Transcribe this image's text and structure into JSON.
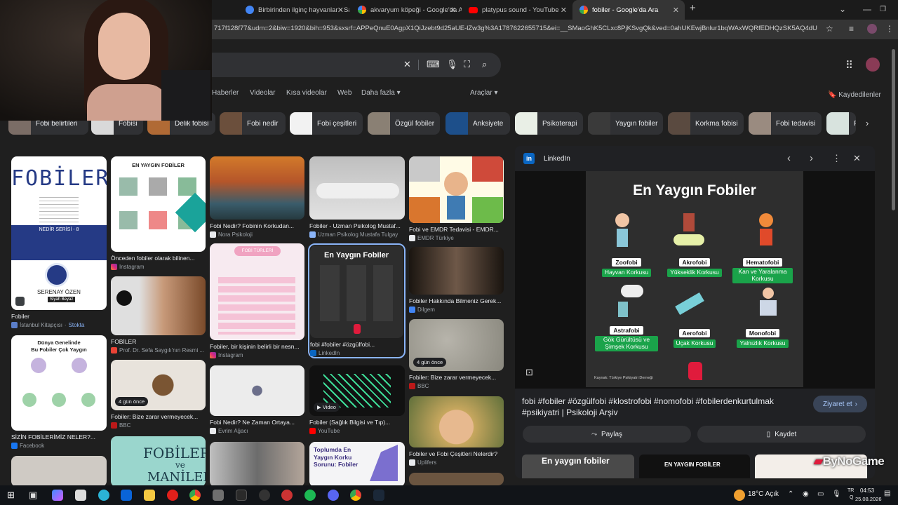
{
  "tabs": [
    {
      "label": "Birbirinden ilginç hayvanlar - Sa",
      "color": "#4285f4"
    },
    {
      "label": "akvaryum köpeği - Google'da A",
      "color": "#fbbc05"
    },
    {
      "label": "platypus sound - YouTube",
      "color": "#ff0000"
    },
    {
      "label": "fobiler - Google'da Ara",
      "color": "#fbbc05"
    }
  ],
  "new_tab": "+",
  "url": "717f128f77&udm=2&biw=1920&bih=953&sxsrf=APPeQnuE0AgpX1QiJzebt9d25aUE-lZw3g%3A1787622655715&ei=__SMaoGhK5CLxc8PjKSvgQk&ved=0ahUKEwjBnlur1bqWAxWQRfEDHQzSK5AQ4dUDCBA&...",
  "nav": {
    "items": [
      "Haberler",
      "Videolar",
      "Kısa videolar",
      "Web",
      "Daha fazla",
      "Araçlar"
    ],
    "saved": "Kaydedilenler"
  },
  "chips": [
    {
      "label": "Fobi belirtileri",
      "color": "#7b6d66"
    },
    {
      "label": "Fobisi",
      "color": "#d9d9d9"
    },
    {
      "label": "Delik fobisi",
      "color": "#b06a35"
    },
    {
      "label": "Fobi nedir",
      "color": "#6b4f3c"
    },
    {
      "label": "Fobi çeşitleri",
      "color": "#f2f2f2"
    },
    {
      "label": "Özgül fobiler",
      "color": "#8a8074"
    },
    {
      "label": "Anksiyete",
      "color": "#1d4f8a"
    },
    {
      "label": "Psikoterapi",
      "color": "#e9efe6"
    },
    {
      "label": "Yaygın fobiler",
      "color": "#3a3a3a"
    },
    {
      "label": "Korkma fobisi",
      "color": "#5a4a40"
    },
    {
      "label": "Fobi tedavisi",
      "color": "#9a8b80"
    },
    {
      "label": "F",
      "color": "#d8e3de"
    }
  ],
  "col1": {
    "c1_title": "FOBİLER",
    "c1_sub": "NEDİR SERİSİ - 8",
    "c1_author": "SERENAY ÖZEN",
    "c1_tag": "Siyah Beyaz",
    "c1_caption": "Fobiler",
    "c1_source": "İstanbul Kitapçısı",
    "c1_stock": "Stokta",
    "c2_top": "Dünya Genelinde",
    "c2_title": "Bu Fobiler Çok Yaygın",
    "c2_caption": "SİZİN FOBİLERİMİZ NELER?...",
    "c2_source": "Facebook"
  },
  "col2": {
    "c1_head": "EN YAYGIN FOBİLER",
    "c1_caption": "Önceden fobiler olarak bilinen...",
    "c1_source": "Instagram",
    "c2_caption": "FOBİLER",
    "c2_source": "Prof. Dr. Sefa Saygılı'nın Resmi ...",
    "c3_badge": "4 gün önce",
    "c3_caption": "Fobiler: Bize zarar vermeyecek...",
    "c3_source": "BBC",
    "c4_title": "FOBİLER",
    "c4_amp": "ve",
    "c4_more": "MANİLER"
  },
  "col3": {
    "c1_caption": "Fobi Nedir? Fobinin Korkudan...",
    "c1_source": "Nora Psikoloji",
    "c2_head": "FOBİ TÜRLERİ",
    "c2_caption": "Fobiler, bir kişinin belirli bir nesn...",
    "c2_source": "Instagram",
    "c3_caption": "Fobi Nedir? Ne Zaman Ortaya...",
    "c3_source": "Evrim Ağacı"
  },
  "col4": {
    "c1_caption": "Fobiler - Uzman Psikolog Mustaf...",
    "c1_source": "Uzman Psikolog Mustafa Tulgay",
    "c2_head": "En Yaygın Fobiler",
    "c2_caption": "fobi #fobiler #özgülfobi...",
    "c2_source": "LinkedIn",
    "c3_video": "Video",
    "c3_caption": "Fobiler (Sağlık Bilgisi ve Tıp)...",
    "c3_source": "YouTube",
    "c4_line1": "Toplumda En",
    "c4_line2": "Yaygın Korku",
    "c4_line3": "Sorunu: Fobiler"
  },
  "col5": {
    "c1_caption": "Fobi ve EMDR Tedavisi - EMDR...",
    "c1_source": "EMDR Türkiye",
    "c2_caption": "Fobiler Hakkında Bilmeniz Gerek...",
    "c2_source": "Dilgem",
    "c3_badge": "4 gün önce",
    "c3_caption": "Fobiler: Bize zarar vermeyecek...",
    "c3_source": "BBC",
    "c4_caption": "Fobiler ve Fobi Çeşitleri Nelerdir?",
    "c4_source": "Uplifers"
  },
  "panel": {
    "site": "LinkedIn",
    "img_title": "En Yaygın Fobiler",
    "phobias": [
      {
        "name": "Zoofobi",
        "desc": "Hayvan Korkusu"
      },
      {
        "name": "Akrofobi",
        "desc": "Yükseklik Korkusu"
      },
      {
        "name": "Hematofobi",
        "desc": "Kan ve Yaralanma Korkusu"
      },
      {
        "name": "Astrafobi",
        "desc": "Gök Gürültüsü ve Şimşek Korkusu"
      },
      {
        "name": "Aerofobi",
        "desc": "Uçak Korkusu"
      },
      {
        "name": "Monofobi",
        "desc": "Yalnızlık Korkusu"
      }
    ],
    "source_note": "Kaynak: Türkiye Psikiyatri Derneği",
    "title": "fobi #fobiler #özgülfobi #klostrofobi #nomofobi #fobilerdenkurtulmak #psikiyatri | Psikoloji Arşiv",
    "visit": "Ziyaret et",
    "share": "Paylaş",
    "save": "Kaydet",
    "related": [
      "En yaygın fobiler",
      "EN YAYGIN FOBİLER"
    ]
  },
  "watermark": "ByNoGame",
  "taskbar": {
    "weather": "18°C Açık",
    "time": "04:53",
    "date": "25.08.2026"
  }
}
